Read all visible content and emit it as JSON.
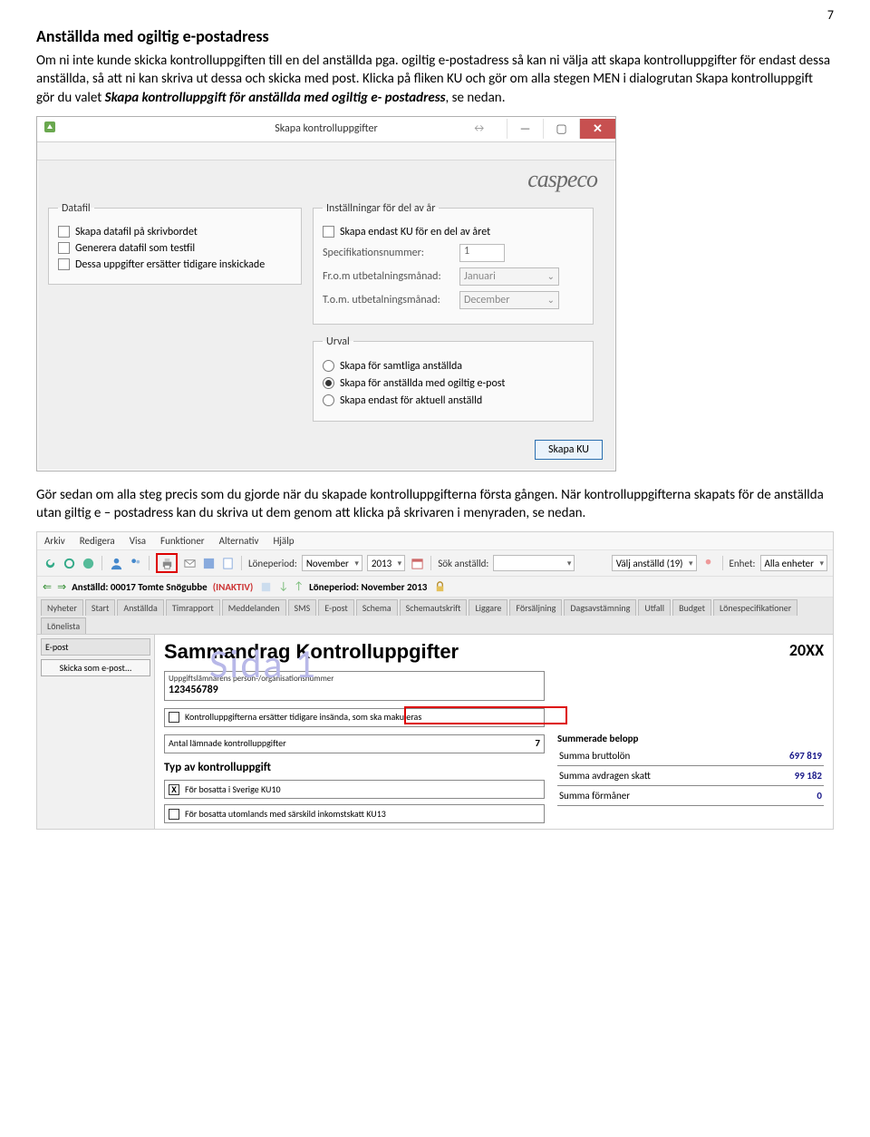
{
  "page_number": "7",
  "heading": "Anställda med ogiltig e-postadress",
  "para1": "Om ni inte kunde skicka kontrolluppgiften till en del anställda pga. ogiltig e-postadress så kan ni välja att skapa kontrolluppgifter för endast dessa anställda, så att ni kan skriva ut dessa och skicka med post. Klicka på fliken KU och gör om alla stegen MEN i dialogrutan Skapa kontrolluppgift gör du valet ",
  "para1_emph": "Skapa kontrolluppgift för anställda med ogiltig e- postadress",
  "para1_tail": ", se nedan.",
  "dialog": {
    "title": "Skapa kontrolluppgifter",
    "minimize": "—",
    "maximize": "▢",
    "close": "✕",
    "resize": "↔",
    "logo": "caspeco",
    "datafil": {
      "legend": "Datafil",
      "c1": "Skapa datafil på skrivbordet",
      "c2": "Generera datafil som testfil",
      "c3": "Dessa uppgifter ersätter tidigare inskickade"
    },
    "settings": {
      "legend": "Inställningar för del av år",
      "c1": "Skapa endast KU för en del av året",
      "spec_label": "Specifikationsnummer:",
      "spec_value": "1",
      "from_label": "Fr.o.m utbetalningsmånad:",
      "from_value": "Januari",
      "to_label": "T.o.m. utbetalningsmånad:",
      "to_value": "December"
    },
    "urval": {
      "legend": "Urval",
      "r1": "Skapa för samtliga anställda",
      "r2": "Skapa för anställda med ogiltig e-post",
      "r3": "Skapa endast för aktuell anställd"
    },
    "submit": "Skapa KU"
  },
  "para2": "Gör sedan om alla steg precis som du gjorde när du skapade kontrolluppgifterna första gången. När kontrolluppgifterna skapats för de anställda utan giltig e – postadress kan du skriva ut dem genom att klicka på skrivaren i menyraden, se nedan.",
  "app": {
    "menu": [
      "Arkiv",
      "Redigera",
      "Visa",
      "Funktioner",
      "Alternativ",
      "Hjälp"
    ],
    "toolbar": {
      "period_label": "Löneperiod:",
      "period_month": "November",
      "period_year": "2013",
      "search_label": "Sök anställd:",
      "choose_label": "Välj anställd (19)",
      "unit_label": "Enhet:",
      "unit_value": "Alla enheter"
    },
    "row2": {
      "employee_label": "Anställd: 00017 Tomte Snögubbe",
      "inactive": "(INAKTIV)",
      "period": "Löneperiod: November 2013"
    },
    "tabs": [
      "Nyheter",
      "Start",
      "Anställda",
      "Timrapport",
      "Meddelanden",
      "SMS",
      "E-post",
      "Schema",
      "Schemautskrift",
      "Liggare",
      "Försäljning",
      "Dagsavstämning",
      "Utfall",
      "Budget",
      "Lönespecifikationer",
      "Lönelista"
    ],
    "side": {
      "header": "E-post",
      "button": "Skicka som e-post..."
    },
    "doc": {
      "title": "Sammandrag Kontrolluppgifter",
      "watermark": "Sida 1",
      "year": "20XX",
      "org_label": "Uppgiftslämnarens person-/organisationsnummer",
      "org_value": "123456789",
      "replace_label": "Kontrolluppgifterna ersätter tidigare insända, som ska makuleras",
      "count_label": "Antal lämnade kontrolluppgifter",
      "count_value": "7",
      "type_header": "Typ av kontrolluppgift",
      "type1": "För bosatta i Sverige KU10",
      "type2": "För bosatta utomlands med särskild inkomstskatt KU13",
      "sum_header": "Summerade belopp",
      "sum_rows": [
        {
          "label": "Summa bruttolön",
          "amount": "697 819"
        },
        {
          "label": "Summa avdragen skatt",
          "amount": "99 182"
        },
        {
          "label": "Summa förmåner",
          "amount": "0"
        }
      ]
    }
  }
}
